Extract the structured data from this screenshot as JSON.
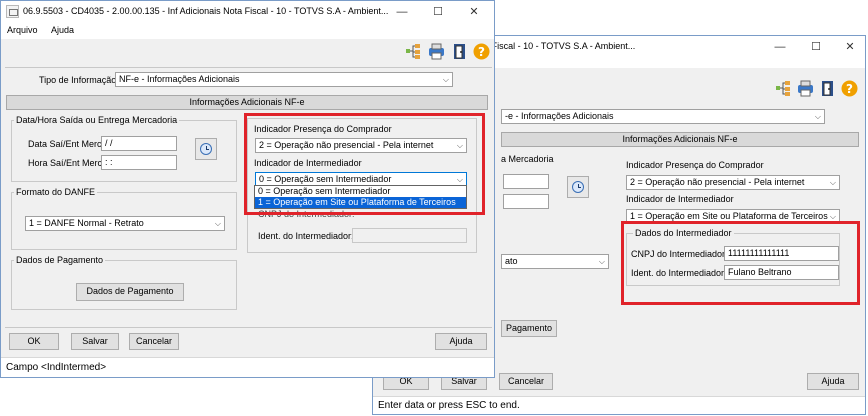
{
  "back_window": {
    "title": "00.135 - Inf Adicionais Nota Fiscal - 10 - TOTVS S.A - Ambient...",
    "window_controls": {
      "minimize": "—",
      "maximize": "☐",
      "close": "✕"
    },
    "tipo_value": "-e - Informações Adicionais",
    "section_header": "Informações Adicionais NF-e",
    "data_hora_partial": "a Mercadoria",
    "indicador_presenca_label": "Indicador Presença do Comprador",
    "indicador_presenca_value": "2 = Operação não presencial - Pela internet",
    "indicador_intermediador_label": "Indicador de Intermediador",
    "indicador_intermediador_value": "1 = Operação em Site ou Plataforma de Terceiros",
    "dados_intermediador_title": "Dados do Intermediador",
    "cnpj_label": "CNPJ do Intermediador:",
    "cnpj_value": "11111111111111",
    "ident_label": "Ident. do Intermediador:",
    "ident_value": "Fulano Beltrano",
    "danfe_partial": "ato",
    "pagamento_partial": "Pagamento",
    "buttons": {
      "ok": "OK",
      "salvar": "Salvar",
      "cancelar": "Cancelar",
      "ajuda": "Ajuda"
    },
    "status": "Enter data or press ESC to end."
  },
  "front_window": {
    "title": "06.9.5503 - CD4035 - 2.00.00.135 - Inf Adicionais Nota Fiscal - 10 - TOTVS S.A - Ambient...",
    "window_controls": {
      "minimize": "—",
      "maximize": "☐",
      "close": "✕"
    },
    "menu": [
      "Arquivo",
      "Ajuda"
    ],
    "tipo_label": "Tipo de Informação:",
    "tipo_value": "NF-e - Informações Adicionais",
    "section_header": "Informações Adicionais NF-e",
    "data_hora_title": "Data/Hora Saída ou Entrega Mercadoria",
    "data_label": "Data Saí/Ent Merc:",
    "data_value": " / /",
    "hora_label": "Hora Saí/Ent Merc:",
    "hora_value": " : :",
    "formato_title": "Formato do DANFE",
    "formato_value": "1 = DANFE Normal - Retrato",
    "pagamento_title": "Dados de Pagamento",
    "pagamento_button": "Dados de Pagamento",
    "indicador_presenca_label": "Indicador Presença do Comprador",
    "indicador_presenca_value": "2 = Operação não presencial - Pela internet",
    "indicador_intermediador_label": "Indicador de Intermediador",
    "indicador_intermediador_value": "0 = Operação sem Intermediador",
    "dropdown_options": [
      "0 = Operação sem Intermediador",
      "1 = Operação em Site ou Plataforma de Terceiros"
    ],
    "cnpj_partial": "CNPJ do Intermediador:",
    "ident_label": "Ident. do Intermediador:",
    "buttons": {
      "ok": "OK",
      "salvar": "Salvar",
      "cancelar": "Cancelar",
      "ajuda": "Ajuda"
    },
    "status": "Campo <IndIntermed>"
  },
  "colors": {
    "highlight": "#e0232a",
    "selection": "#0a64d7",
    "help_icon": "#f0a000"
  },
  "icons": [
    "tree-icon",
    "printer-icon",
    "exit-door-icon",
    "help-icon",
    "clock-icon"
  ]
}
